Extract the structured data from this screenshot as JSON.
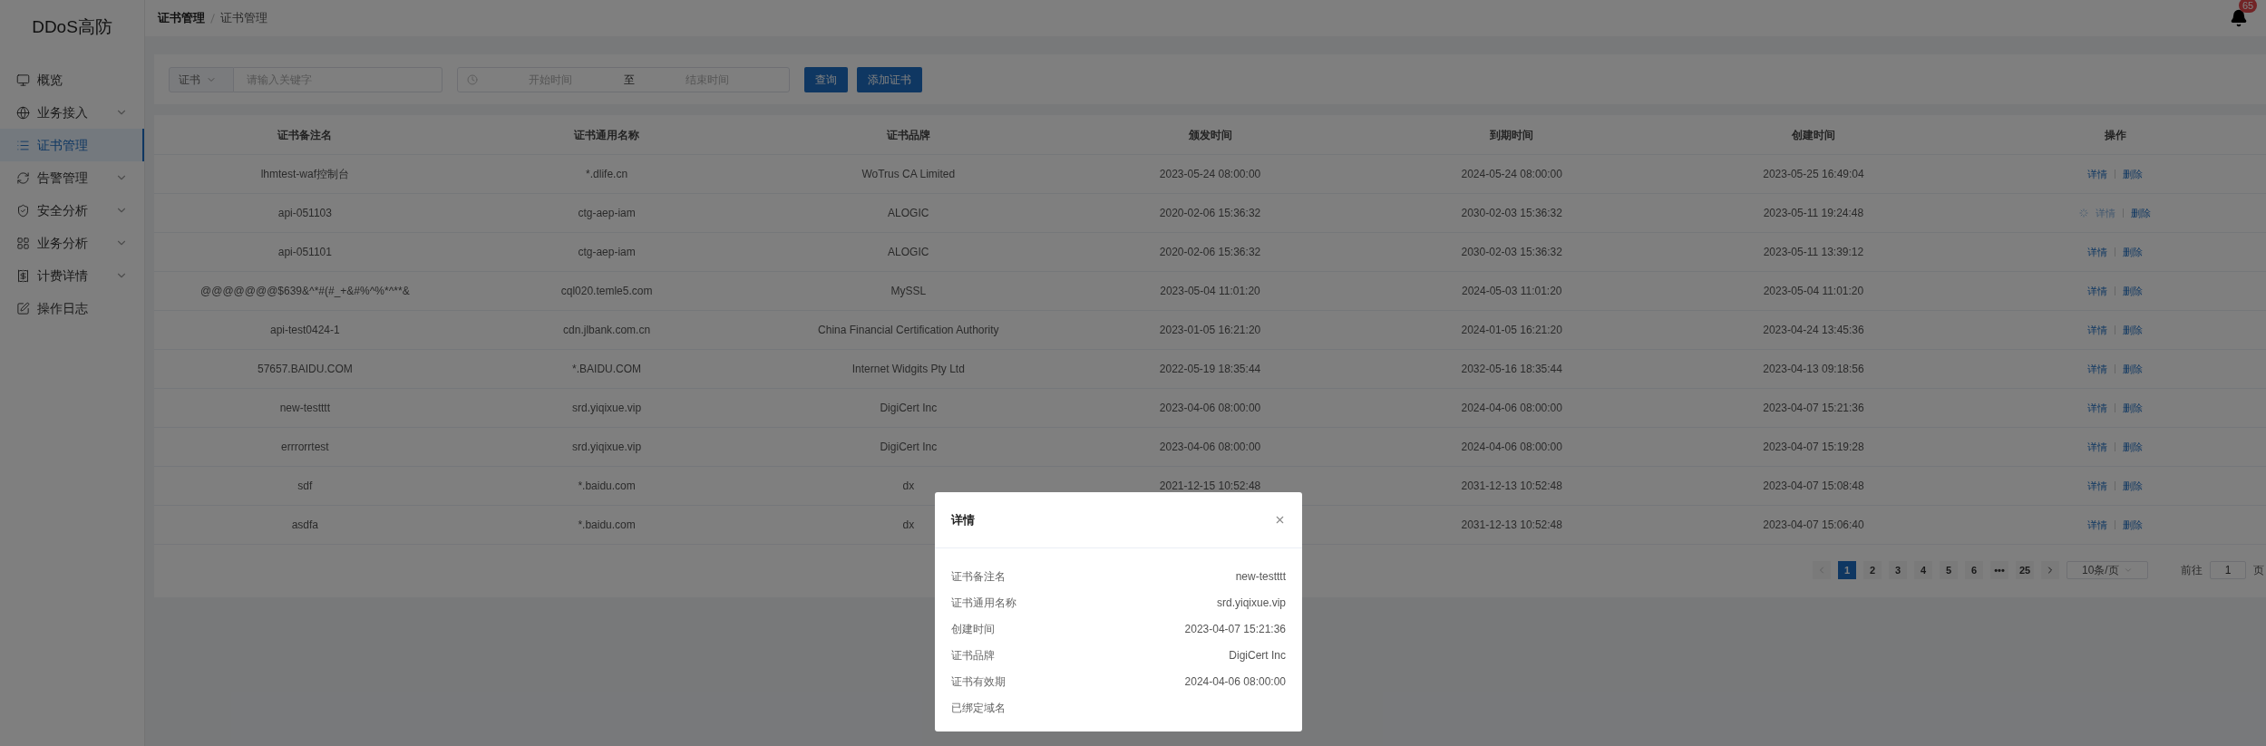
{
  "logo": "DDoS高防",
  "sidebar": {
    "items": [
      {
        "label": "概览",
        "selected": false,
        "expandable": false
      },
      {
        "label": "业务接入",
        "selected": false,
        "expandable": true
      },
      {
        "label": "证书管理",
        "selected": true,
        "expandable": false
      },
      {
        "label": "告警管理",
        "selected": false,
        "expandable": true
      },
      {
        "label": "安全分析",
        "selected": false,
        "expandable": true
      },
      {
        "label": "业务分析",
        "selected": false,
        "expandable": true
      },
      {
        "label": "计费详情",
        "selected": false,
        "expandable": true
      },
      {
        "label": "操作日志",
        "selected": false,
        "expandable": false
      }
    ]
  },
  "breadcrumb": [
    "证书管理",
    "证书管理"
  ],
  "notifications": {
    "count": "65"
  },
  "filters": {
    "field_select": "证书",
    "keyword": {
      "placeholder": "请输入关键字"
    },
    "date_range": {
      "start_placeholder": "开始时间",
      "separator": "至",
      "end_placeholder": "结束时间"
    },
    "buttons": [
      "查询",
      "添加证书"
    ]
  },
  "table": {
    "columns": [
      "证书备注名",
      "证书通用名称",
      "证书品牌",
      "颁发时间",
      "到期时间",
      "创建时间",
      "操作"
    ],
    "rows": [
      {
        "cells": [
          "lhmtest-waf控制台",
          "*.dlife.cn",
          "WoTrus CA Limited",
          "2023-05-24 08:00:00",
          "2024-05-24 08:00:00",
          "2023-05-25 16:49:04"
        ],
        "actions": [
          "详情",
          "删除"
        ],
        "loading": false
      },
      {
        "cells": [
          "api-051103",
          "ctg-aep-iam",
          "ALOGIC",
          "2020-02-06 15:36:32",
          "2030-02-03 15:36:32",
          "2023-05-11 19:24:48"
        ],
        "actions": [
          "详情",
          "删除"
        ],
        "loading": true
      },
      {
        "cells": [
          "api-051101",
          "ctg-aep-iam",
          "ALOGIC",
          "2020-02-06 15:36:32",
          "2030-02-03 15:36:32",
          "2023-05-11 13:39:12"
        ],
        "actions": [
          "详情",
          "删除"
        ],
        "loading": false
      },
      {
        "cells": [
          "@@@@@@@$639&^*#(#_+&#%^%*^**&",
          "cql020.temle5.com",
          "MySSL",
          "2023-05-04 11:01:20",
          "2024-05-03 11:01:20",
          "2023-05-04 11:01:20"
        ],
        "actions": [
          "详情",
          "删除"
        ],
        "loading": false
      },
      {
        "cells": [
          "api-test0424-1",
          "cdn.jlbank.com.cn",
          "China Financial Certification Authority",
          "2023-01-05 16:21:20",
          "2024-01-05 16:21:20",
          "2023-04-24 13:45:36"
        ],
        "actions": [
          "详情",
          "删除"
        ],
        "loading": false
      },
      {
        "cells": [
          "57657.BAIDU.COM",
          "*.BAIDU.COM",
          "Internet Widgits Pty Ltd",
          "2022-05-19 18:35:44",
          "2032-05-16 18:35:44",
          "2023-04-13 09:18:56"
        ],
        "actions": [
          "详情",
          "删除"
        ],
        "loading": false
      },
      {
        "cells": [
          "new-testttt",
          "srd.yiqixue.vip",
          "DigiCert Inc",
          "2023-04-06 08:00:00",
          "2024-04-06 08:00:00",
          "2023-04-07 15:21:36"
        ],
        "actions": [
          "详情",
          "删除"
        ],
        "loading": false
      },
      {
        "cells": [
          "errrorrtest",
          "srd.yiqixue.vip",
          "DigiCert Inc",
          "2023-04-06 08:00:00",
          "2024-04-06 08:00:00",
          "2023-04-07 15:19:28"
        ],
        "actions": [
          "详情",
          "删除"
        ],
        "loading": false
      },
      {
        "cells": [
          "sdf",
          "*.baidu.com",
          "dx",
          "2021-12-15 10:52:48",
          "2031-12-13 10:52:48",
          "2023-04-07 15:08:48"
        ],
        "actions": [
          "详情",
          "删除"
        ],
        "loading": false
      },
      {
        "cells": [
          "asdfa",
          "*.baidu.com",
          "dx",
          "",
          "2031-12-13 10:52:48",
          "2023-04-07 15:06:40"
        ],
        "actions": [
          "详情",
          "删除"
        ],
        "loading": false
      }
    ]
  },
  "pagination": {
    "pages": [
      {
        "label": "1",
        "selected": true
      },
      {
        "label": "2",
        "selected": false
      },
      {
        "label": "3",
        "selected": false
      },
      {
        "label": "4",
        "selected": false
      },
      {
        "label": "5",
        "selected": false
      },
      {
        "label": "6",
        "selected": false
      },
      {
        "label": "•••",
        "selected": false
      },
      {
        "label": "25",
        "selected": false
      }
    ],
    "page_size": "10条/页",
    "goto_label": "前往",
    "goto_value": "1",
    "goto_suffix": "页"
  },
  "dialog": {
    "title": "详情",
    "fields": [
      {
        "label": "证书备注名",
        "value": "new-testttt"
      },
      {
        "label": "证书通用名称",
        "value": "srd.yiqixue.vip"
      },
      {
        "label": "创建时间",
        "value": "2023-04-07 15:21:36"
      },
      {
        "label": "证书品牌",
        "value": "DigiCert Inc"
      },
      {
        "label": "证书有效期",
        "value": "2024-04-06 08:00:00"
      },
      {
        "label": "已绑定域名"
      }
    ]
  }
}
